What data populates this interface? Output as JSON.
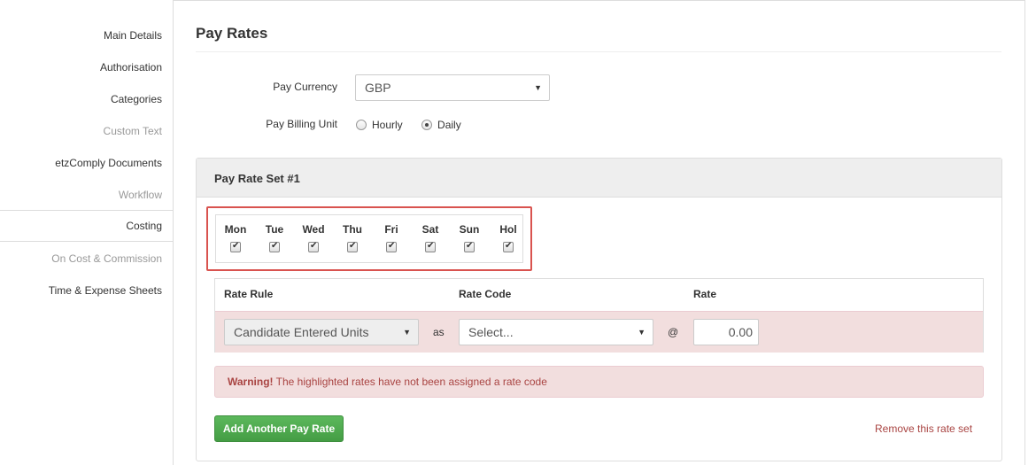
{
  "sidebar": {
    "items": [
      {
        "label": "Main Details",
        "state": "normal"
      },
      {
        "label": "Authorisation",
        "state": "normal"
      },
      {
        "label": "Categories",
        "state": "normal"
      },
      {
        "label": "Custom Text",
        "state": "disabled"
      },
      {
        "label": "etzComply Documents",
        "state": "normal"
      },
      {
        "label": "Workflow",
        "state": "disabled"
      },
      {
        "label": "Costing",
        "state": "active"
      },
      {
        "label": "On Cost & Commission",
        "state": "disabled"
      },
      {
        "label": "Time & Expense Sheets",
        "state": "normal"
      }
    ]
  },
  "page": {
    "title": "Pay Rates",
    "pay_currency_label": "Pay Currency",
    "pay_currency_value": "GBP",
    "billing_unit_label": "Pay Billing Unit",
    "billing_unit_options": [
      {
        "label": "Hourly",
        "checked": false
      },
      {
        "label": "Daily",
        "checked": true
      }
    ]
  },
  "rate_set": {
    "title": "Pay Rate Set #1",
    "days": [
      {
        "label": "Mon",
        "checked": true
      },
      {
        "label": "Tue",
        "checked": true
      },
      {
        "label": "Wed",
        "checked": true
      },
      {
        "label": "Thu",
        "checked": true
      },
      {
        "label": "Fri",
        "checked": true
      },
      {
        "label": "Sat",
        "checked": true
      },
      {
        "label": "Sun",
        "checked": true
      },
      {
        "label": "Hol",
        "checked": true
      }
    ],
    "table": {
      "headers": {
        "rate_rule": "Rate Rule",
        "rate_code": "Rate Code",
        "rate": "Rate"
      },
      "row": {
        "rate_rule": "Candidate Entered Units",
        "as_label": "as",
        "rate_code": "Select...",
        "at_label": "@",
        "rate": "0.00"
      }
    },
    "warning": {
      "strong": "Warning!",
      "text": " The highlighted rates have not been assigned a rate code"
    },
    "add_button": "Add Another Pay Rate",
    "remove_link": "Remove this rate set"
  },
  "colors": {
    "warning_bg": "#f2dede",
    "warning_text": "#a94442",
    "success": "#5cb85c",
    "highlight_border": "#d9534f"
  }
}
